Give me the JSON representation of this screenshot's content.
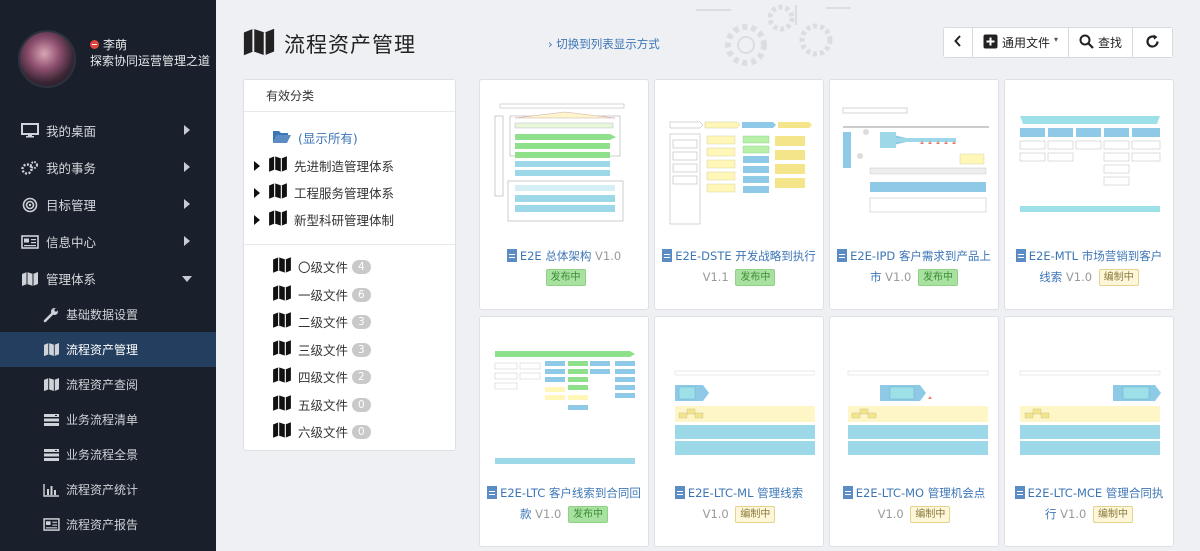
{
  "user": {
    "name": "李萌",
    "dept": "探索协同运营管理之道"
  },
  "nav": [
    {
      "label": "我的桌面",
      "icon": "monitor-icon"
    },
    {
      "label": "我的事务",
      "icon": "gears-icon"
    },
    {
      "label": "目标管理",
      "icon": "target-icon"
    },
    {
      "label": "信息中心",
      "icon": "newspaper-icon"
    },
    {
      "label": "管理体系",
      "icon": "map-icon"
    }
  ],
  "subnav": [
    {
      "label": "基础数据设置",
      "icon": "wrench-icon"
    },
    {
      "label": "流程资产管理",
      "icon": "map-icon"
    },
    {
      "label": "流程资产查阅",
      "icon": "map-icon"
    },
    {
      "label": "业务流程清单",
      "icon": "server-icon"
    },
    {
      "label": "业务流程全景",
      "icon": "server-icon"
    },
    {
      "label": "流程资产统计",
      "icon": "bar-chart-icon"
    },
    {
      "label": "流程资产报告",
      "icon": "newspaper-icon"
    }
  ],
  "header": {
    "title": "流程资产管理",
    "switch_link": "› 切换到列表显示方式",
    "common_file": "通用文件",
    "search": "查找"
  },
  "categories": {
    "heading": "有效分类",
    "show_all": "(显示所有)",
    "systems": [
      "先进制造管理体系",
      "工程服务管理体系",
      "新型科研管理体制"
    ],
    "levels": [
      {
        "label": "〇级文件",
        "count": "4"
      },
      {
        "label": "一级文件",
        "count": "6"
      },
      {
        "label": "二级文件",
        "count": "3"
      },
      {
        "label": "三级文件",
        "count": "3"
      },
      {
        "label": "四级文件",
        "count": "2"
      },
      {
        "label": "五级文件",
        "count": "0"
      },
      {
        "label": "六级文件",
        "count": "0"
      }
    ]
  },
  "cards": [
    {
      "title": "E2E 总体架构",
      "version": "V1.0",
      "status": "发布中",
      "status_type": "pub"
    },
    {
      "title": "E2E-DSTE 开发战略到执行",
      "version": "V1.1",
      "status": "发布中",
      "status_type": "pub"
    },
    {
      "title": "E2E-IPD 客户需求到产品上市",
      "version": "V1.0",
      "status": "发布中",
      "status_type": "pub"
    },
    {
      "title": "E2E-MTL 市场营销到客户线索",
      "version": "V1.0",
      "status": "编制中",
      "status_type": "draft"
    },
    {
      "title": "E2E-LTC 客户线索到合同回款",
      "version": "V1.0",
      "status": "发布中",
      "status_type": "pub"
    },
    {
      "title": "E2E-LTC-ML 管理线索",
      "version": "V1.0",
      "status": "编制中",
      "status_type": "draft"
    },
    {
      "title": "E2E-LTC-MO 管理机会点",
      "version": "V1.0",
      "status": "编制中",
      "status_type": "draft"
    },
    {
      "title": "E2E-LTC-MCE 管理合同执行",
      "version": "V1.0",
      "status": "编制中",
      "status_type": "draft"
    }
  ],
  "colors": {
    "sidebar": "#19202b",
    "active": "#233e5e",
    "accent": "#3d76b6",
    "pub": "#a9e2a0",
    "draft": "#fdf6d9"
  }
}
